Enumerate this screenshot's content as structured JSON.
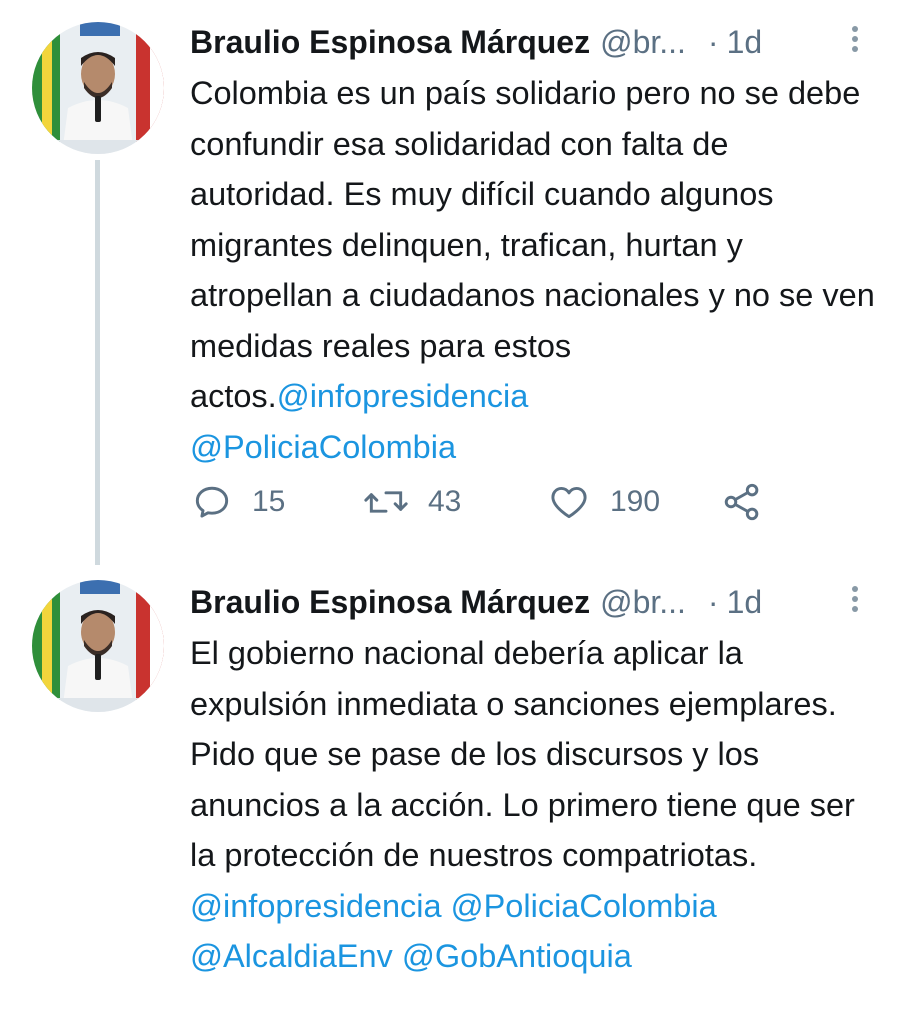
{
  "tweets": [
    {
      "author_name": "Braulio Espinosa Márquez",
      "handle": "@br...",
      "separator": "·",
      "time": "1d",
      "text_main": "Colombia es un país solidario pero no se debe confundir esa solidaridad con falta de autoridad. Es muy difícil cuando algunos migrantes delinquen, trafican, hurtan y atropellan a ciudadanos nacionales y no se ven medidas reales para estos actos.",
      "mention_1": "@infopresidencia",
      "mention_2": "@PoliciaColombia",
      "replies": "15",
      "retweets": "43",
      "likes": "190"
    },
    {
      "author_name": "Braulio Espinosa Márquez",
      "handle": "@br...",
      "separator": "·",
      "time": "1d",
      "text_main": "El gobierno nacional debería aplicar la expulsión inmediata o sanciones ejemplares. Pido que se pase de los discursos y los anuncios a la acción. Lo primero tiene que ser la protección de nuestros compatriotas.",
      "mention_1": "@infopresidencia",
      "mention_2": "@PoliciaColombia",
      "mention_3": "@AlcaldiaEnv",
      "mention_4": "@GobAntioquia"
    }
  ],
  "icons": {
    "reply": "reply-icon",
    "retweet": "retweet-icon",
    "like": "heart-icon",
    "share": "share-icon",
    "more": "more-vertical-icon"
  },
  "colors": {
    "link": "#1b95e0",
    "secondary_text": "#5b7083",
    "thread_line": "#cfd9de"
  }
}
